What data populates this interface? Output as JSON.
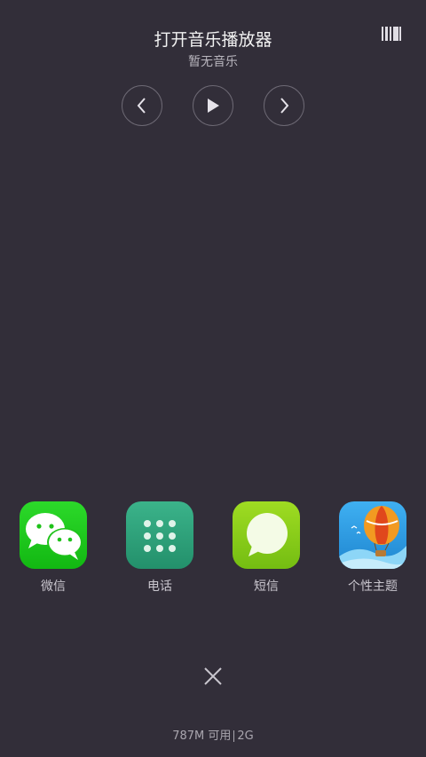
{
  "music": {
    "title": "打开音乐播放器",
    "subtitle": "暂无音乐",
    "prev_icon": "chevron-left-icon",
    "play_icon": "play-icon",
    "next_icon": "chevron-right-icon"
  },
  "apps": [
    {
      "label": "微信",
      "icon": "wechat-icon",
      "color": "#1fc21a"
    },
    {
      "label": "电话",
      "icon": "dialpad-icon",
      "color": "#2ea07a"
    },
    {
      "label": "短信",
      "icon": "message-bubble-icon",
      "color": "#8ccd1a"
    },
    {
      "label": "个性主题",
      "icon": "hot-air-balloon-icon",
      "color": "#2e9be0"
    }
  ],
  "footer": {
    "memory_free": "787M 可用",
    "memory_total": "2G"
  },
  "colors": {
    "background": "#322e39",
    "control_border": "#6d6974"
  }
}
